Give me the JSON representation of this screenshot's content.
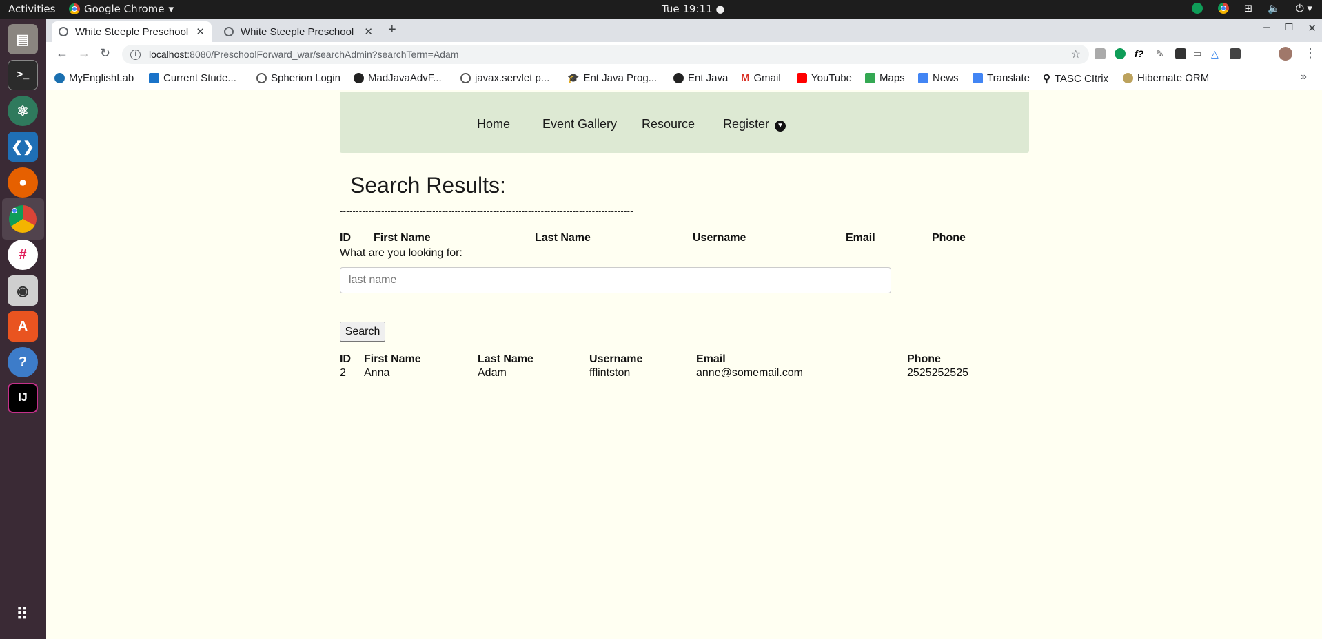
{
  "system": {
    "activities": "Activities",
    "app_name": "Google Chrome",
    "clock": "Tue 19:11"
  },
  "browser": {
    "tabs": [
      {
        "title": "White Steeple Preschool"
      },
      {
        "title": "White Steeple Preschool"
      }
    ],
    "url_host": "localhost",
    "url_rest": ":8080/PreschoolForward_war/searchAdmin?searchTerm=Adam",
    "bookmarks": [
      "MyEnglishLab",
      "Current Stude...",
      "Spherion Login",
      "MadJavaAdvF...",
      "javax.servlet p...",
      "Ent Java Prog...",
      "Ent Java",
      "Gmail",
      "YouTube",
      "Maps",
      "News",
      "Translate",
      "TASC CItrix",
      "Hibernate ORM"
    ]
  },
  "nav": {
    "home": "Home",
    "gallery": "Event Gallery",
    "resource": "Resource",
    "register": "Register"
  },
  "main": {
    "title": "Search Results:",
    "divider": "--------------------------------------------------------------------------------------------",
    "top_headers": [
      "ID",
      "First Name",
      "Last Name",
      "Username",
      "Email",
      "Phone"
    ],
    "search_label": "What are you looking for:",
    "search_placeholder": "last name",
    "search_button": "Search",
    "result_headers": [
      "ID",
      "First Name",
      "Last Name",
      "Username",
      "Email",
      "Phone"
    ],
    "rows": [
      [
        "2",
        "Anna",
        "Adam",
        "fflintston",
        "anne@somemail.com",
        "2525252525"
      ]
    ]
  }
}
